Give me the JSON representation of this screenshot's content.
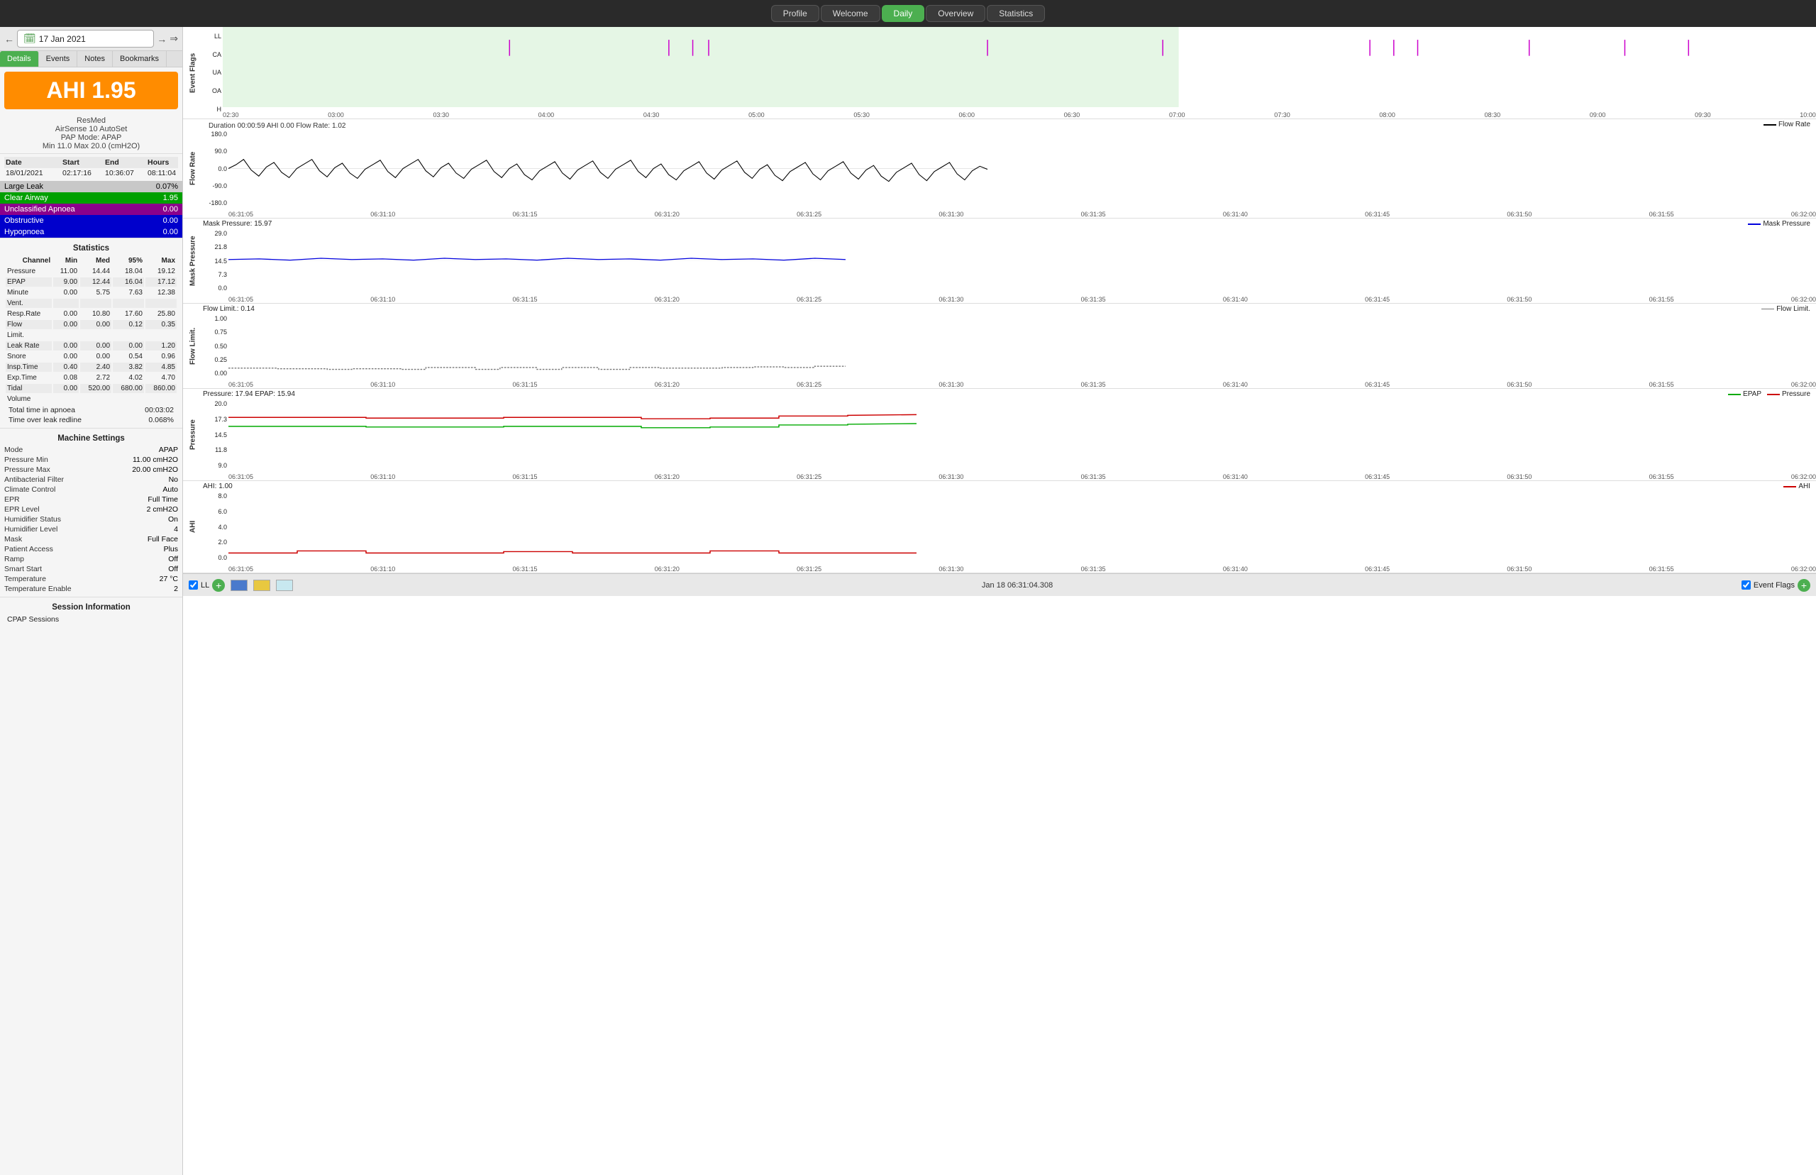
{
  "nav": {
    "items": [
      "Profile",
      "Welcome",
      "Daily",
      "Overview",
      "Statistics"
    ],
    "active": "Daily"
  },
  "date_nav": {
    "date": "17 Jan 2021"
  },
  "left_tabs": [
    "Details",
    "Events",
    "Notes",
    "Bookmarks"
  ],
  "active_tab": "Details",
  "ahi": {
    "value": "AHI 1.95",
    "device": "ResMed",
    "model": "AirSense 10 AutoSet",
    "pap_mode": "PAP Mode: APAP",
    "min_max": "Min 11.0 Max 20.0 (cmH2O)"
  },
  "session": {
    "headers": [
      "Date",
      "Start",
      "End",
      "Hours"
    ],
    "rows": [
      [
        "18/01/2021",
        "02:17:16",
        "10:36:07",
        "08:11:04"
      ]
    ]
  },
  "events": [
    {
      "label": "Large Leak",
      "value": "0.07%",
      "class": "event-large-leak"
    },
    {
      "label": "Clear Airway",
      "value": "1.95",
      "class": "event-clear-airway"
    },
    {
      "label": "Unclassified Apnoea",
      "value": "0.00",
      "class": "event-unclassified"
    },
    {
      "label": "Obstructive",
      "value": "0.00",
      "class": "event-obstructive"
    },
    {
      "label": "Hypopnoea",
      "value": "0.00",
      "class": "event-hypopnoea"
    }
  ],
  "statistics": {
    "title": "Statistics",
    "headers": [
      "Channel",
      "Min",
      "Med",
      "95%",
      "Max"
    ],
    "rows": [
      [
        "Pressure",
        "11.00",
        "14.44",
        "18.04",
        "19.12"
      ],
      [
        "EPAP",
        "9.00",
        "12.44",
        "16.04",
        "17.12"
      ],
      [
        "Minute",
        "0.00",
        "5.75",
        "7.63",
        "12.38"
      ],
      [
        "Vent.",
        "",
        "",
        "",
        ""
      ],
      [
        "Resp.Rate",
        "0.00",
        "10.80",
        "17.60",
        "25.80"
      ],
      [
        "Flow",
        "0.00",
        "0.00",
        "0.12",
        "0.35"
      ],
      [
        "Limit.",
        "",
        "",
        "",
        ""
      ],
      [
        "Leak Rate",
        "0.00",
        "0.00",
        "0.00",
        "1.20"
      ],
      [
        "Snore",
        "0.00",
        "0.00",
        "0.54",
        "0.96"
      ],
      [
        "Insp.Time",
        "0.40",
        "2.40",
        "3.82",
        "4.85"
      ],
      [
        "Exp.Time",
        "0.08",
        "2.72",
        "4.02",
        "4.70"
      ],
      [
        "Tidal",
        "0.00",
        "520.00",
        "680.00",
        "860.00"
      ],
      [
        "Volume",
        "",
        "",
        "",
        ""
      ]
    ],
    "totals": [
      {
        "label": "Total time in apnoea",
        "value": "00:03:02"
      },
      {
        "label": "Time over leak redline",
        "value": "0.068%"
      }
    ]
  },
  "machine_settings": {
    "title": "Machine Settings",
    "items": [
      {
        "label": "Mode",
        "value": "APAP"
      },
      {
        "label": "Pressure Min",
        "value": "11.00 cmH2O"
      },
      {
        "label": "Pressure Max",
        "value": "20.00 cmH2O"
      },
      {
        "label": "Antibacterial Filter",
        "value": "No"
      },
      {
        "label": "Climate Control",
        "value": "Auto"
      },
      {
        "label": "EPR",
        "value": "Full Time"
      },
      {
        "label": "EPR Level",
        "value": "2 cmH2O"
      },
      {
        "label": "Humidifier Status",
        "value": "On"
      },
      {
        "label": "Humidifier Level",
        "value": "4"
      },
      {
        "label": "Mask",
        "value": "Full Face"
      },
      {
        "label": "Patient Access",
        "value": "Plus"
      },
      {
        "label": "Ramp",
        "value": "Off"
      },
      {
        "label": "Smart Start",
        "value": "Off"
      },
      {
        "label": "Temperature",
        "value": "27 °C"
      },
      {
        "label": "Temperature Enable",
        "value": "2"
      }
    ]
  },
  "session_info": {
    "title": "Session Information",
    "subtitle": "CPAP Sessions"
  },
  "charts": {
    "event_flags": {
      "title": "Event Flags",
      "rows": [
        "LL",
        "CA",
        "UA",
        "OA",
        "H"
      ],
      "time_range": "02:30 to 10:00"
    },
    "flow_rate": {
      "title": "Duration 00:00:59 AHI 0.00 Flow Rate: 1.02",
      "legend": "Flow Rate",
      "y_max": 180.0,
      "y_mid": 90.0,
      "y_zero": 0.0,
      "y_neg": -90.0,
      "y_min": -180.0,
      "time_start": "06:31:05",
      "time_end": "06:32:00"
    },
    "mask_pressure": {
      "title": "Mask Pressure: 15.97",
      "legend": "Mask Pressure",
      "y_max": 29.0,
      "y_mid": 21.8,
      "y_ref": 14.5,
      "y_low": 7.3,
      "y_min": 0.0
    },
    "flow_limit": {
      "title": "Flow Limit.: 0.14",
      "legend": "Flow Limit.",
      "y_max": 1.0,
      "y_75": 0.75,
      "y_50": 0.5,
      "y_25": 0.25,
      "y_min": 0.0
    },
    "pressure": {
      "title": "Pressure: 17.94 EPAP: 15.94",
      "legends": [
        "EPAP",
        "Pressure"
      ],
      "y_max": 20.0,
      "y_vals": [
        17.3,
        14.5,
        11.8,
        9.0
      ]
    },
    "ahi": {
      "title": "AHI: 1.00",
      "legend": "AHI",
      "y_max": 8.0,
      "y_vals": [
        6.0,
        4.0,
        2.0,
        0.0
      ]
    }
  },
  "bottom_bar": {
    "ll_checked": true,
    "ll_label": "LL",
    "timestamp": "Jan 18 06:31:04.308",
    "event_flags_checked": true,
    "event_flags_label": "Event Flags"
  },
  "colors": {
    "ahi_bg": "#ff8c00",
    "active_tab": "#4caf50",
    "clear_airway": "#00a000",
    "unclassified": "#8b008b",
    "obstructive": "#0000cc",
    "flow_rate_line": "#000000",
    "mask_pressure_line": "#0000dd",
    "flow_limit_line": "#777777",
    "epap_line": "#00aa00",
    "pressure_line": "#cc0000",
    "ahi_line": "#cc0000",
    "event_bg": "#cceecc"
  }
}
